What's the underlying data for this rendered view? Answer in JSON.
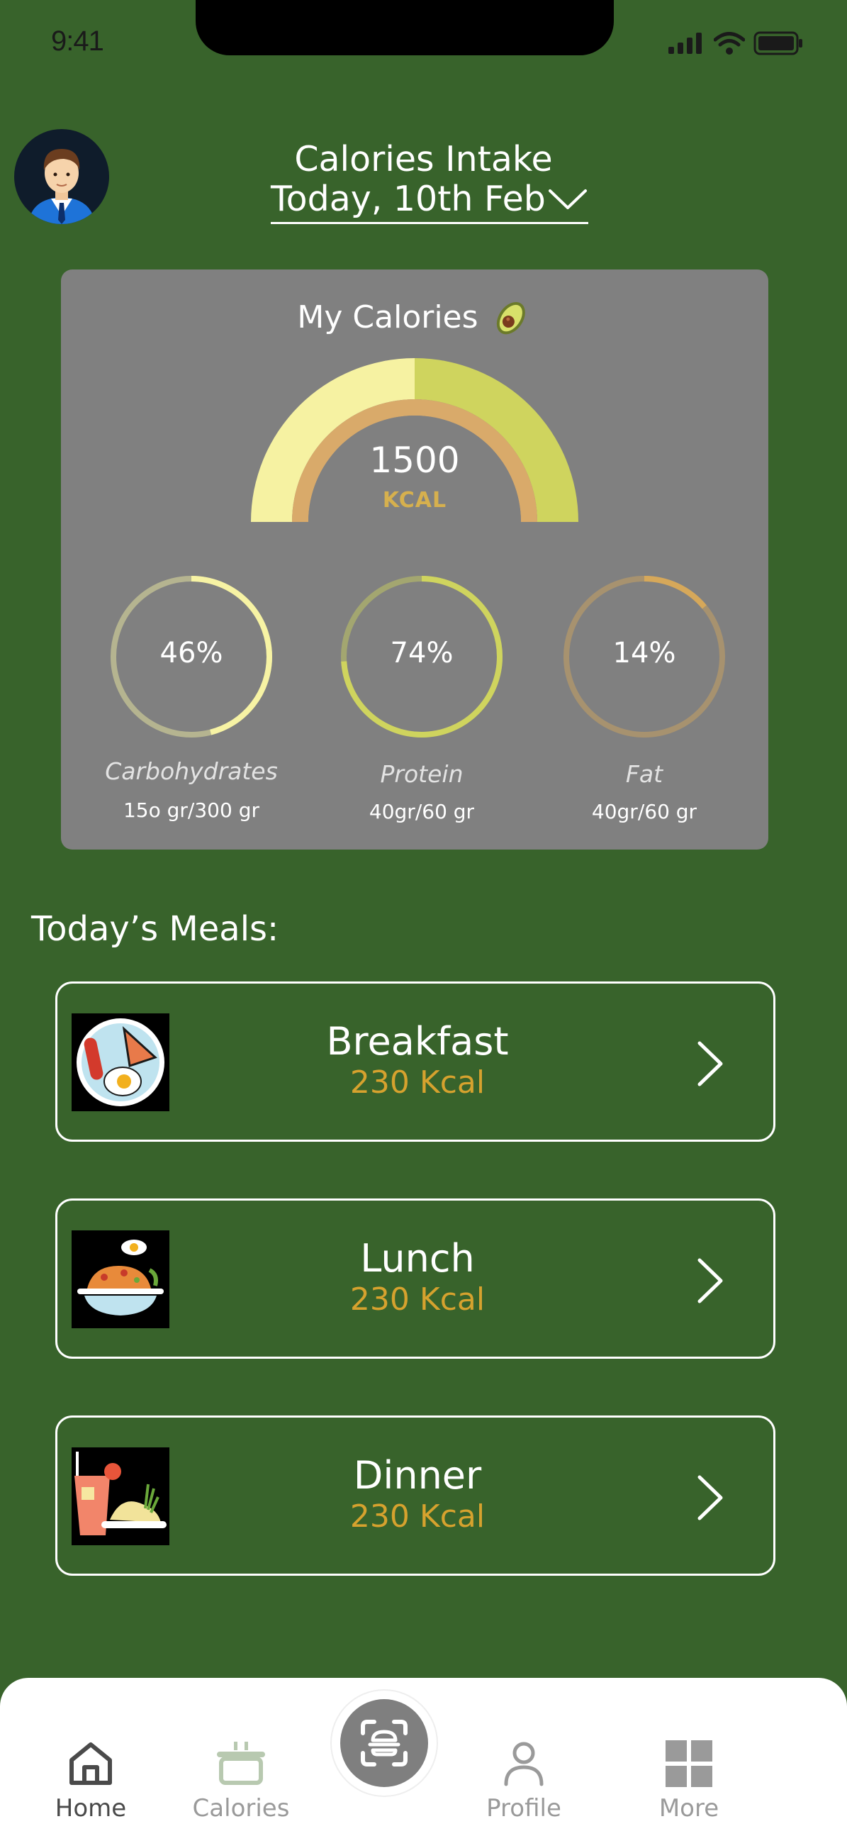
{
  "status_bar": {
    "time": "9:41"
  },
  "header": {
    "title": "Calories Intake",
    "date": "Today, 10th Feb"
  },
  "card": {
    "title": "My Calories",
    "gauge_value": "1500",
    "gauge_unit": "KCAL",
    "gauge_fraction": 0.5,
    "macros": [
      {
        "name": "Carbohydrates",
        "percent_label": "46%",
        "amount": "15o gr/300 gr",
        "percent": 46,
        "color": "#f7f3a4"
      },
      {
        "name": "Protein",
        "percent_label": "74%",
        "amount": "40gr/60 gr",
        "percent": 74,
        "color": "#cfd45e"
      },
      {
        "name": "Fat",
        "percent_label": "14%",
        "amount": "40gr/60 gr",
        "percent": 14,
        "color": "#d6a85a"
      }
    ]
  },
  "meals_title": "Today’s Meals:",
  "meals": [
    {
      "name": "Breakfast",
      "kcal": "230 Kcal"
    },
    {
      "name": "Lunch",
      "kcal": "230 Kcal"
    },
    {
      "name": "Dinner",
      "kcal": "230 Kcal"
    }
  ],
  "nav": {
    "home": "Home",
    "calories": "Calories",
    "profile": "Profile",
    "more": "More"
  },
  "colors": {
    "background": "#38632b",
    "card": "#808080",
    "accent_kcal": "#d6a22e"
  }
}
